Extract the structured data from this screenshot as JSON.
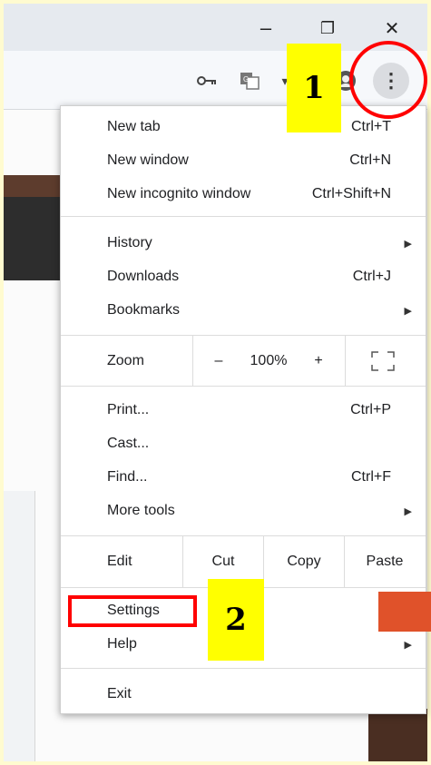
{
  "window": {
    "minimize_icon": "–",
    "restore_icon": "❐",
    "close_icon": "✕"
  },
  "toolbar": {
    "key_icon": "key-icon",
    "translate_icon": "translate-icon",
    "account_icon": "account-icon",
    "menu_icon": "⋮"
  },
  "menu": {
    "new_tab": {
      "label": "New tab",
      "shortcut": "Ctrl+T"
    },
    "new_window": {
      "label": "New window",
      "shortcut": "Ctrl+N"
    },
    "new_incognito": {
      "label": "New incognito window",
      "shortcut": "Ctrl+Shift+N"
    },
    "history": {
      "label": "History"
    },
    "downloads": {
      "label": "Downloads",
      "shortcut": "Ctrl+J"
    },
    "bookmarks": {
      "label": "Bookmarks"
    },
    "zoom": {
      "label": "Zoom",
      "minus": "–",
      "value": "100%",
      "plus": "+"
    },
    "print": {
      "label": "Print...",
      "shortcut": "Ctrl+P"
    },
    "cast": {
      "label": "Cast..."
    },
    "find": {
      "label": "Find...",
      "shortcut": "Ctrl+F"
    },
    "more_tools": {
      "label": "More tools"
    },
    "edit": {
      "label": "Edit",
      "cut": "Cut",
      "copy": "Copy",
      "paste": "Paste"
    },
    "settings": {
      "label": "Settings"
    },
    "help": {
      "label": "Help"
    },
    "exit": {
      "label": "Exit"
    },
    "submenu_arrow": "▶"
  },
  "annotations": {
    "step1": "1",
    "step2": "2",
    "highlight_color": "#ff0000",
    "badge_color": "#ffff00"
  }
}
